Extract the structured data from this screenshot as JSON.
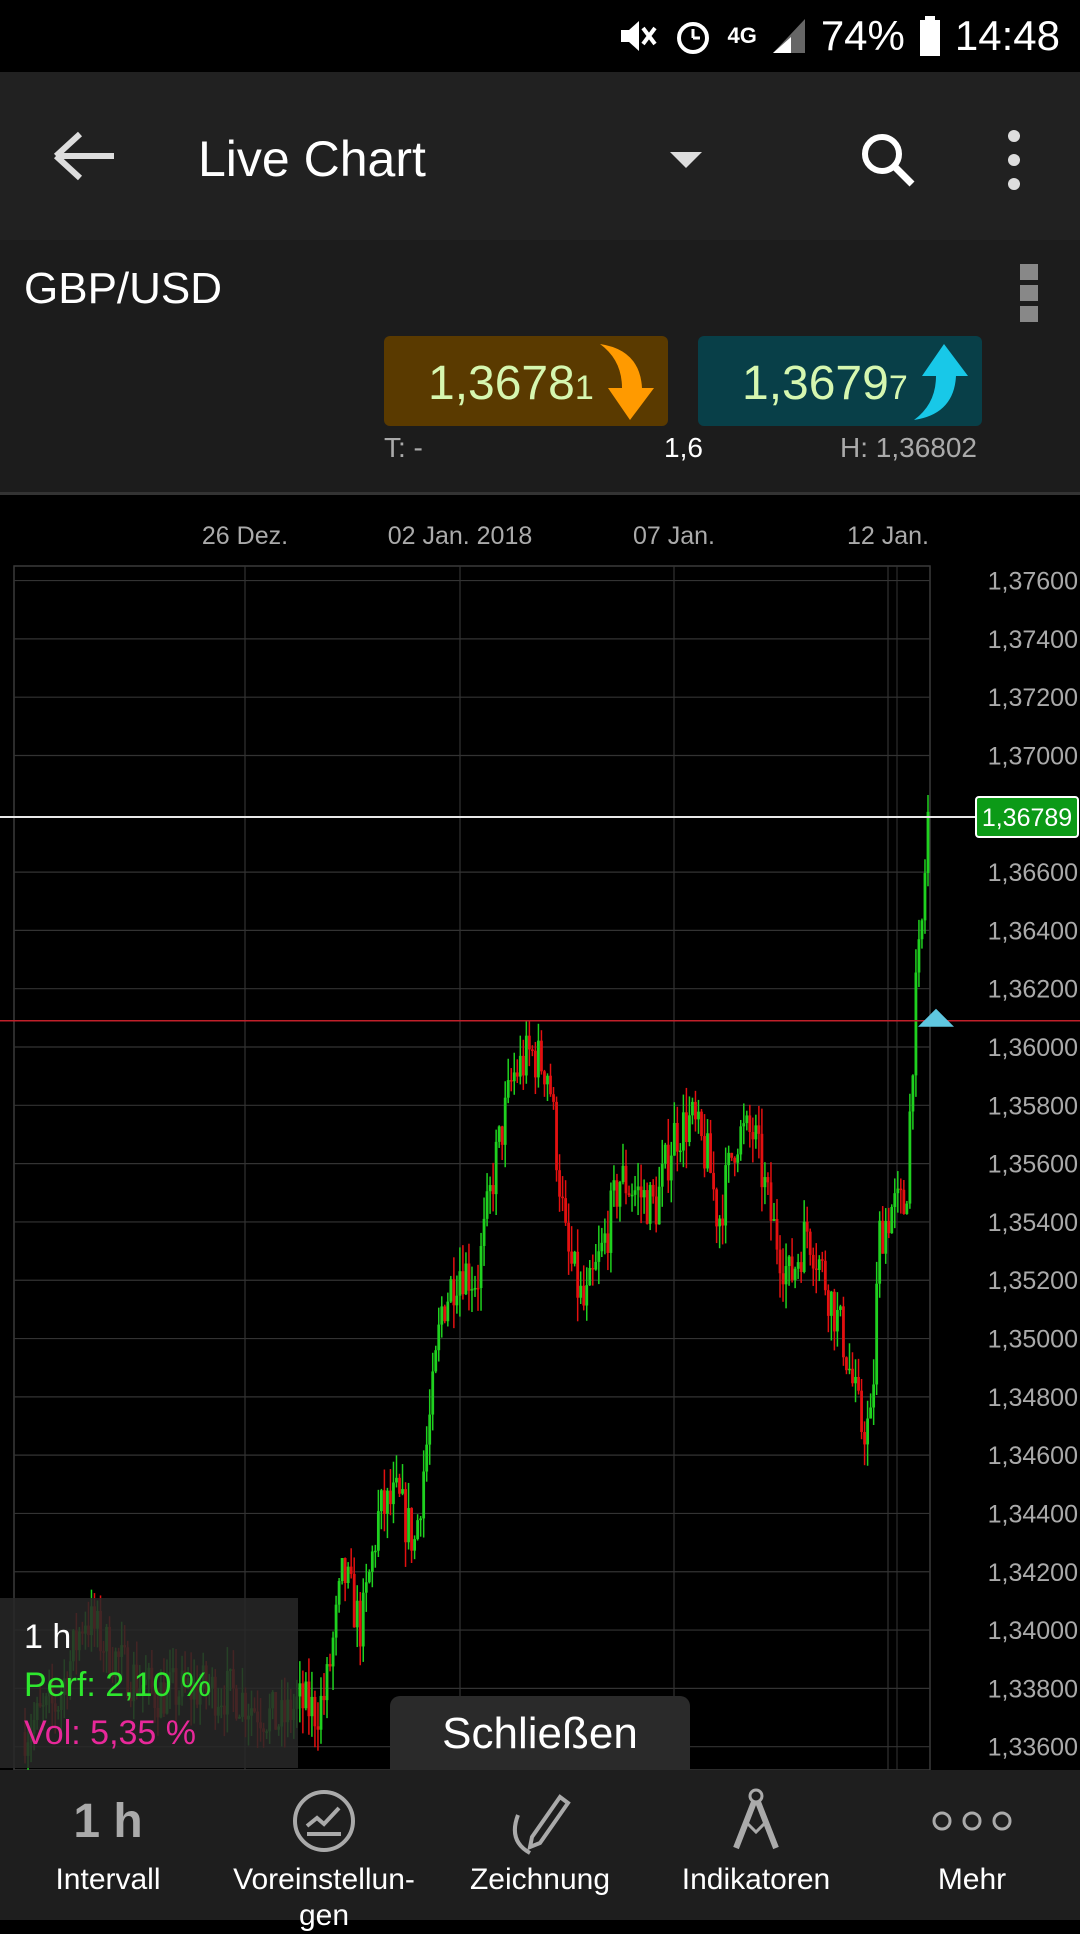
{
  "status_bar": {
    "battery": "74%",
    "time": "14:48",
    "network": "4G"
  },
  "app_bar": {
    "title": "Live Chart"
  },
  "quote": {
    "instrument": "GBP/USD",
    "sell": {
      "main": "1,3678",
      "pip": "1"
    },
    "buy": {
      "main": "1,3679",
      "pip": "7"
    },
    "low_label": "T: -",
    "spread": "1,6",
    "high_label": "H: 1,36802"
  },
  "chart_data": {
    "type": "candlestick",
    "x_tick_labels": [
      "26 Dez.",
      "02 Jan. 2018",
      "07 Jan.",
      "12 Jan."
    ],
    "y_tick_labels": [
      "1,37600",
      "1,37400",
      "1,37200",
      "1,37000",
      "1,36600",
      "1,36400",
      "1,36200",
      "1,36000",
      "1,35800",
      "1,35600",
      "1,35400",
      "1,35200",
      "1,35000",
      "1,34800",
      "1,34600",
      "1,34400",
      "1,34200",
      "1,34000",
      "1,33800",
      "1,33600"
    ],
    "ylim": [
      1.3352,
      1.3765
    ],
    "current_price": 1.36789,
    "current_price_label": "1,36789",
    "reference_price": 1.3609,
    "series_colors": {
      "up": "#1fd11f",
      "down": "#e31010"
    },
    "price_path": [
      [
        0,
        1.3365
      ],
      [
        0.04,
        1.3375
      ],
      [
        0.07,
        1.3405
      ],
      [
        0.1,
        1.3392
      ],
      [
        0.12,
        1.3385
      ],
      [
        0.15,
        1.3378
      ],
      [
        0.2,
        1.338
      ],
      [
        0.24,
        1.3378
      ],
      [
        0.29,
        1.3368
      ],
      [
        0.31,
        1.3375
      ],
      [
        0.33,
        1.3372
      ],
      [
        0.34,
        1.3378
      ],
      [
        0.36,
        1.342
      ],
      [
        0.38,
        1.34
      ],
      [
        0.4,
        1.344
      ],
      [
        0.42,
        1.3445
      ],
      [
        0.44,
        1.343
      ],
      [
        0.46,
        1.348
      ],
      [
        0.47,
        1.351
      ],
      [
        0.49,
        1.3525
      ],
      [
        0.51,
        1.352
      ],
      [
        0.53,
        1.356
      ],
      [
        0.55,
        1.359
      ],
      [
        0.57,
        1.3598
      ],
      [
        0.59,
        1.3592
      ],
      [
        0.61,
        1.353
      ],
      [
        0.63,
        1.351
      ],
      [
        0.65,
        1.353
      ],
      [
        0.67,
        1.3555
      ],
      [
        0.69,
        1.355
      ],
      [
        0.71,
        1.3545
      ],
      [
        0.73,
        1.357
      ],
      [
        0.75,
        1.3575
      ],
      [
        0.77,
        1.356
      ],
      [
        0.78,
        1.354
      ],
      [
        0.8,
        1.357
      ],
      [
        0.82,
        1.357
      ],
      [
        0.84,
        1.354
      ],
      [
        0.86,
        1.352
      ],
      [
        0.88,
        1.3538
      ],
      [
        0.9,
        1.352
      ],
      [
        0.92,
        1.35
      ],
      [
        0.94,
        1.347
      ],
      [
        0.952,
        1.347
      ],
      [
        0.96,
        1.3535
      ],
      [
        0.975,
        1.3545
      ],
      [
        0.99,
        1.3545
      ],
      [
        1.0,
        1.3612
      ],
      [
        1.008,
        1.364
      ],
      [
        1.015,
        1.3679
      ]
    ]
  },
  "overlay": {
    "interval": "1 h",
    "perf": "Perf: 2,10 %",
    "vol": "Vol: 5,35 %",
    "close_button": "Schließen"
  },
  "bottom_nav": [
    {
      "label": "Intervall",
      "icon_text": "1 h",
      "icon": "interval-icon"
    },
    {
      "label": "Voreinstellun-gen",
      "icon": "presets-icon"
    },
    {
      "label": "Zeichnung",
      "icon": "pencil-icon"
    },
    {
      "label": "Indikatoren",
      "icon": "indicators-icon"
    },
    {
      "label": "Mehr",
      "icon": "more-dots-icon"
    }
  ]
}
